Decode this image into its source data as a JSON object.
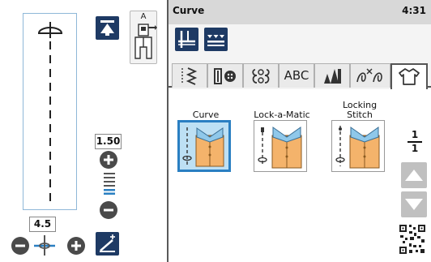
{
  "header": {
    "title": "Curve",
    "clock": "4:31"
  },
  "left_panel": {
    "stitch_length": "1.50",
    "stitch_width": "4.5",
    "presser_foot": "A"
  },
  "tabs": [
    {
      "label": "",
      "icon": "utility-stitch-icon"
    },
    {
      "label": "",
      "icon": "buttonhole-icon"
    },
    {
      "label": "",
      "icon": "decorative-stitch-icon"
    },
    {
      "label": "ABC",
      "icon": ""
    },
    {
      "label": "",
      "icon": "satin-stitch-icon"
    },
    {
      "label": "",
      "icon": "applique-stitch-icon"
    },
    {
      "label": "",
      "icon": "garment-icon"
    }
  ],
  "stitches": [
    {
      "label": "Curve",
      "selected": true
    },
    {
      "label": "Lock-a-Matic",
      "selected": false
    },
    {
      "label": "Locking\nStitch",
      "selected": false
    }
  ],
  "pagination": {
    "current": "1",
    "total": "1"
  },
  "colors": {
    "accent_dark": "#1e3a64",
    "selected_border": "#2a7fc2",
    "selected_fill": "#bde0f4",
    "garment": "#f4b36b"
  }
}
